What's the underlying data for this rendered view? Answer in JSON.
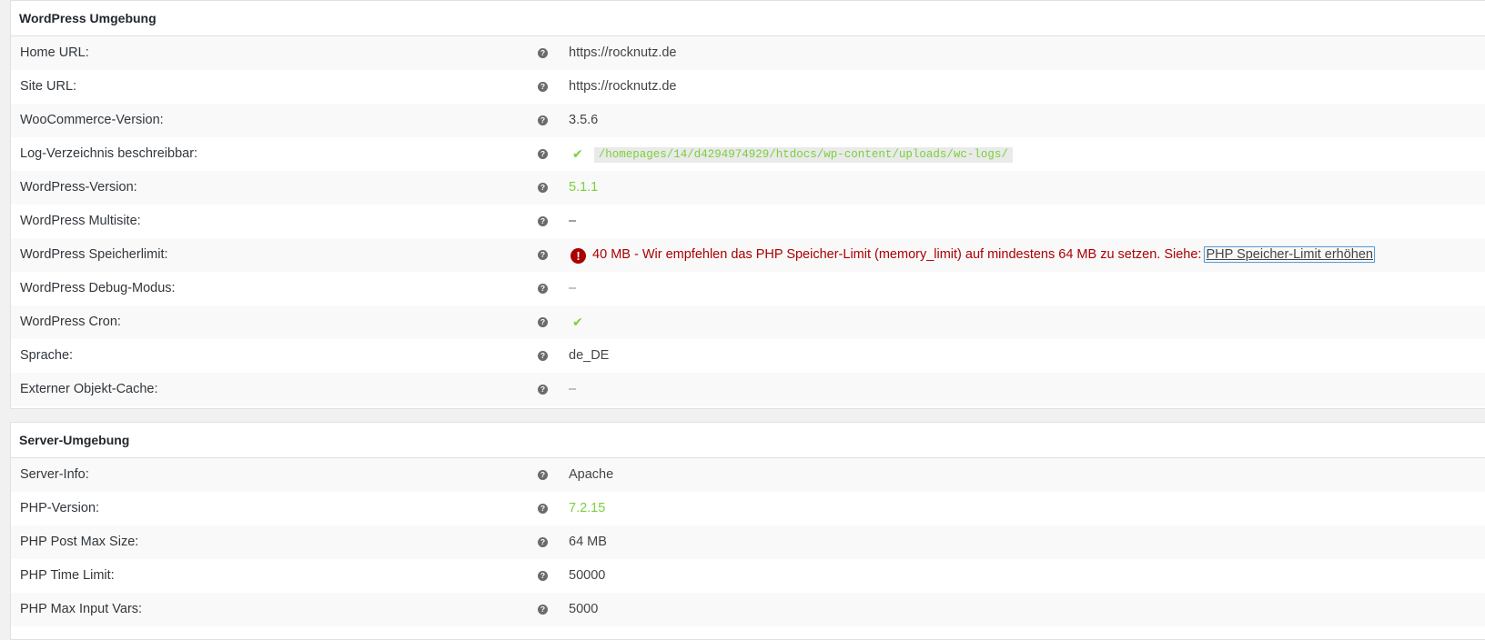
{
  "colors": {
    "ok": "#7ad03a",
    "error": "#aa0000",
    "help_icon": "#6b6b6b"
  },
  "wp_section": {
    "title": "WordPress Umgebung",
    "rows": {
      "home_url": {
        "label": "Home URL:",
        "value": "https://rocknutz.de"
      },
      "site_url": {
        "label": "Site URL:",
        "value": "https://rocknutz.de"
      },
      "wc_version": {
        "label": "WooCommerce-Version:",
        "value": "3.5.6"
      },
      "log_dir": {
        "label": "Log-Verzeichnis beschreibbar:",
        "check": "✔",
        "value": "/homepages/14/d4294974929/htdocs/wp-content/uploads/wc-logs/"
      },
      "wp_version": {
        "label": "WordPress-Version:",
        "value": "5.1.1"
      },
      "multisite": {
        "label": "WordPress Multisite:",
        "value": "–"
      },
      "memory_limit": {
        "label": "WordPress Speicherlimit:",
        "icon": "!",
        "value": "40 MB - Wir empfehlen das PHP Speicher-Limit (memory_limit) auf mindestens 64 MB zu setzen. Siehe:",
        "link": "PHP Speicher-Limit erhöhen"
      },
      "debug_mode": {
        "label": "WordPress Debug-Modus:",
        "value": "–"
      },
      "cron": {
        "label": "WordPress Cron:",
        "check": "✔"
      },
      "language": {
        "label": "Sprache:",
        "value": "de_DE"
      },
      "object_cache": {
        "label": "Externer Objekt-Cache:",
        "value": "–"
      }
    }
  },
  "server_section": {
    "title": "Server-Umgebung",
    "rows": {
      "server_info": {
        "label": "Server-Info:",
        "value": "Apache"
      },
      "php_version": {
        "label": "PHP-Version:",
        "value": "7.2.15"
      },
      "post_max": {
        "label": "PHP Post Max Size:",
        "value": "64 MB"
      },
      "time_limit": {
        "label": "PHP Time Limit:",
        "value": "50000"
      },
      "max_input_vars": {
        "label": "PHP Max Input Vars:",
        "value": "5000"
      }
    }
  },
  "help_glyph": "?"
}
